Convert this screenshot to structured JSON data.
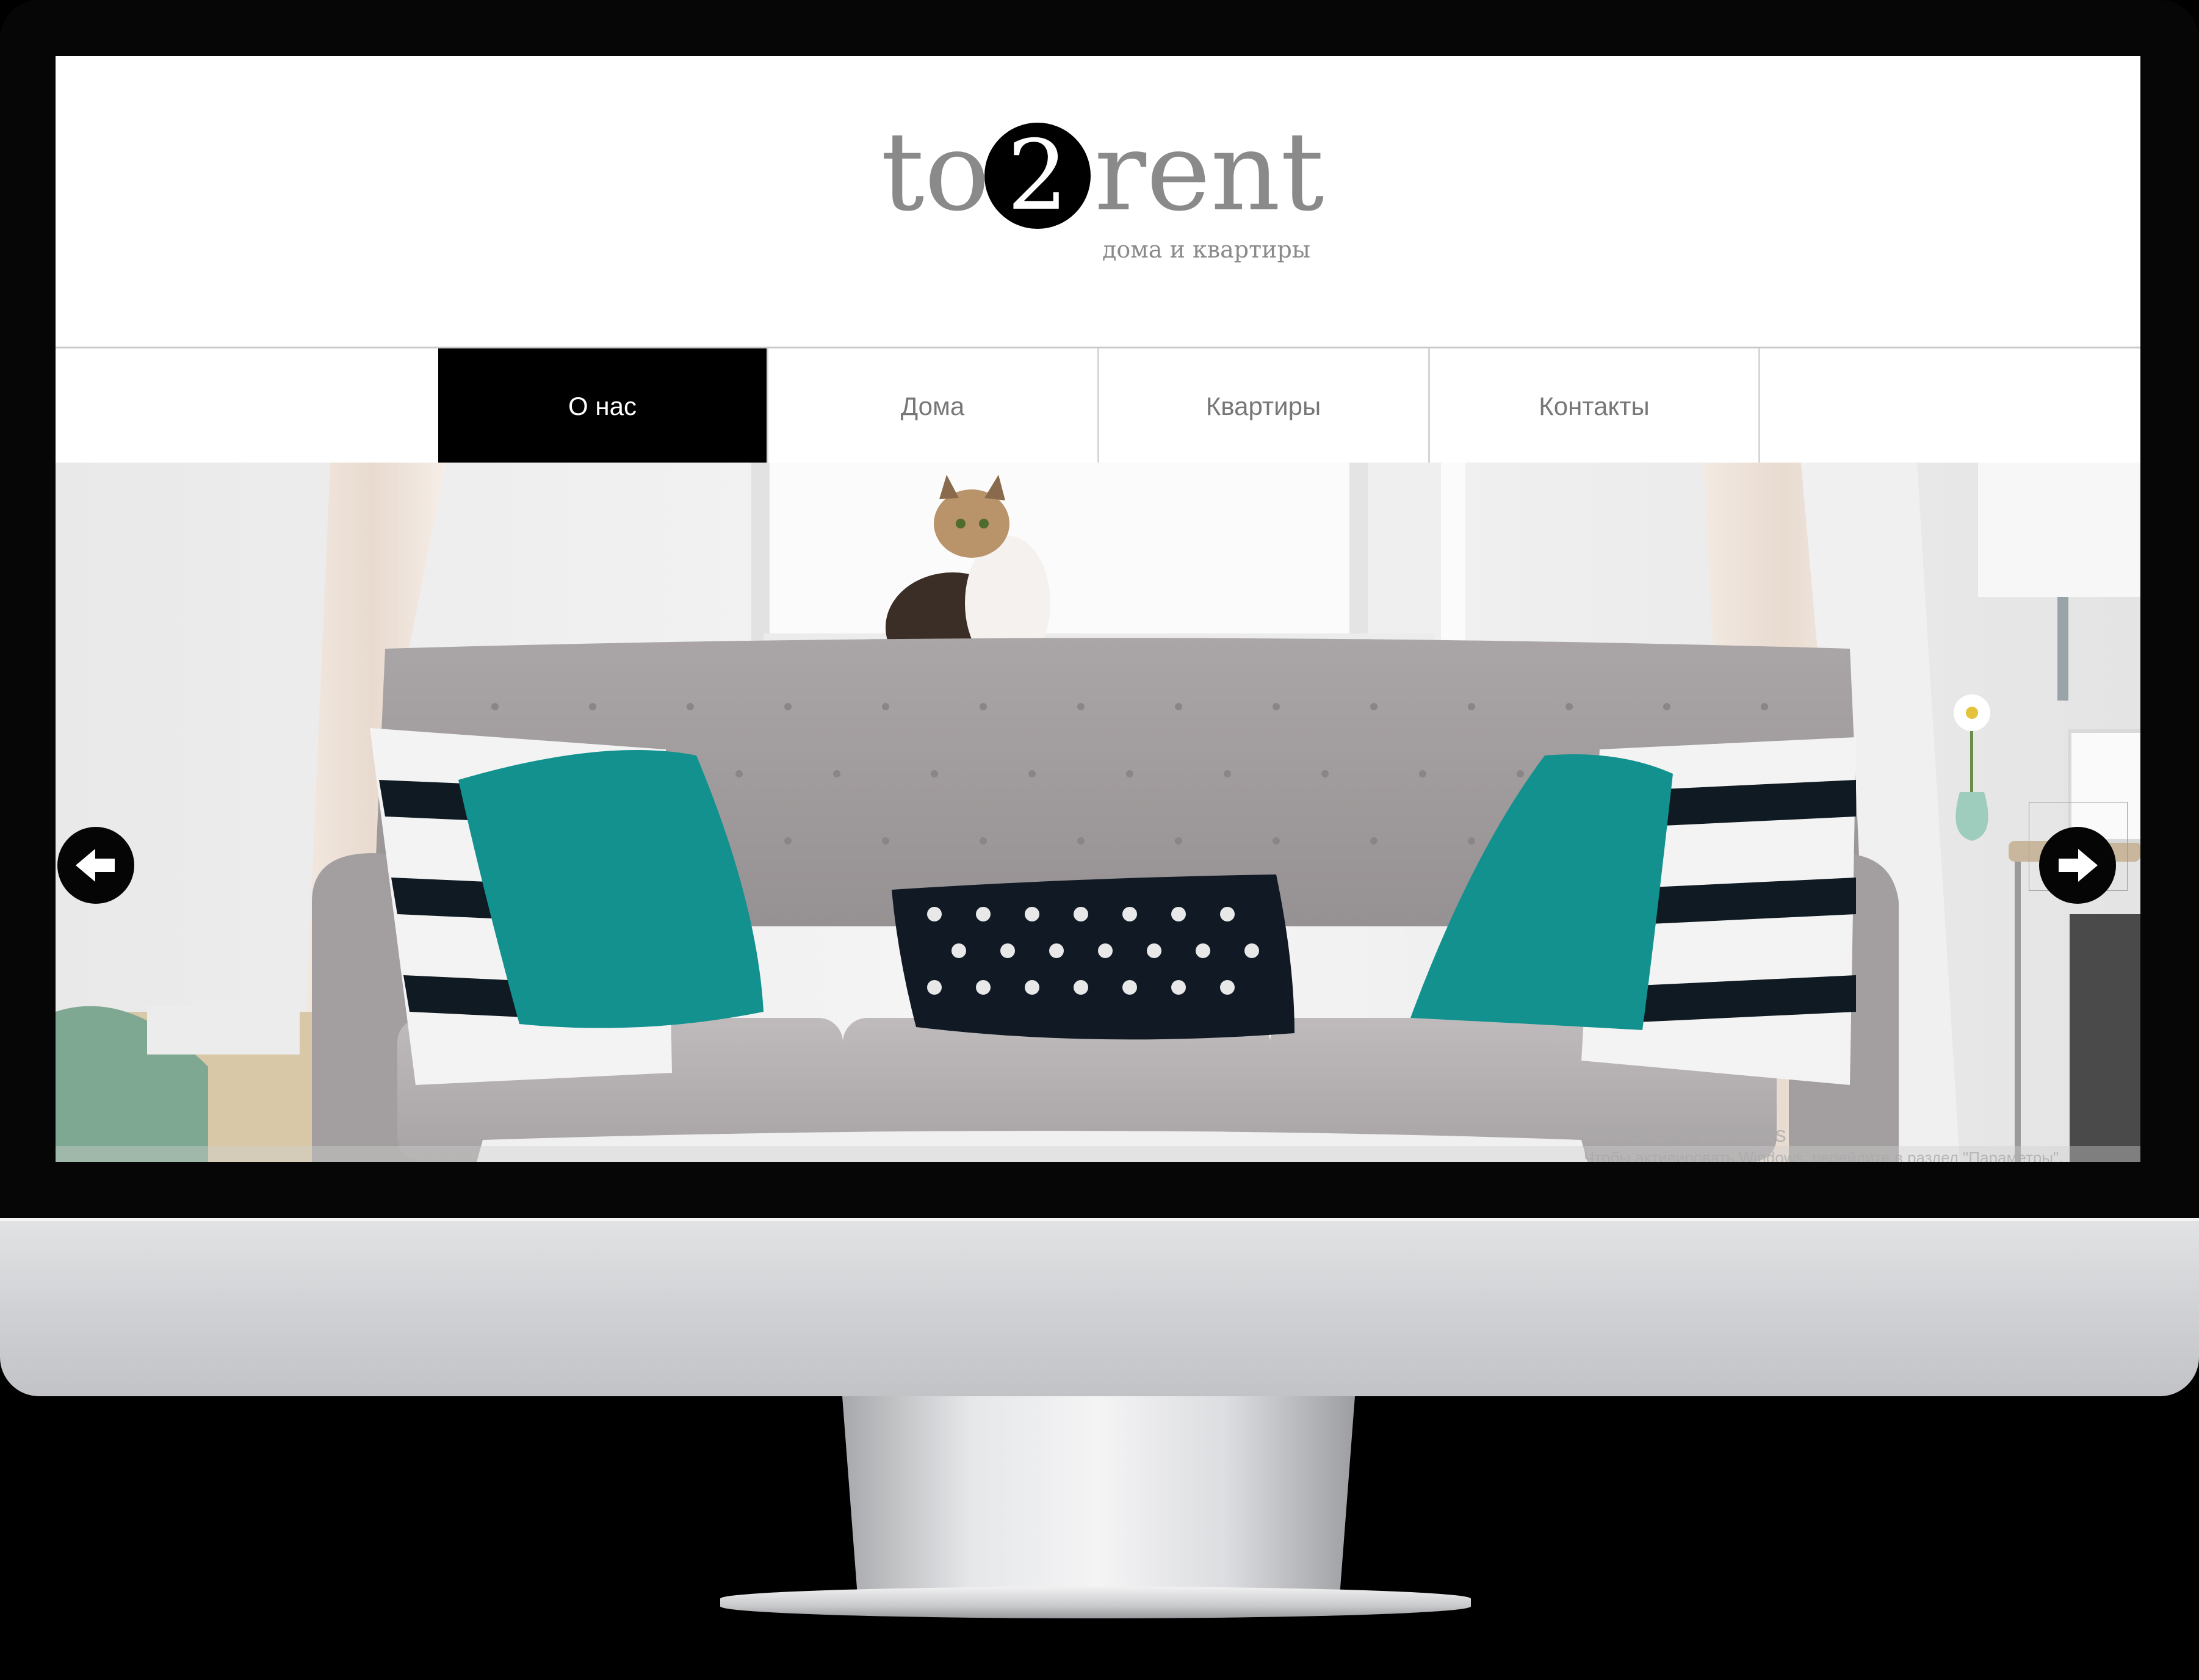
{
  "site": {
    "logo_left": "to",
    "logo_number": "2",
    "logo_right": "rent",
    "tagline": "дома и квартиры"
  },
  "nav": {
    "items": [
      {
        "label": "О нас",
        "active": true
      },
      {
        "label": "Дома",
        "active": false
      },
      {
        "label": "Квартиры",
        "active": false
      },
      {
        "label": "Контакты",
        "active": false
      }
    ]
  },
  "slider": {
    "prev_icon": "arrow-left-icon",
    "next_icon": "arrow-right-icon"
  },
  "os_watermark": {
    "title": "Активация Windows",
    "subtitle": "Чтобы активировать Windows, перейдите в раздел \"Параметры\"."
  },
  "colors": {
    "accent": "#000000",
    "logo_gray": "#8a8a8a",
    "nav_text": "#777777",
    "pillow_teal": "#12918f",
    "sofa_gray": "#a49fa0"
  }
}
